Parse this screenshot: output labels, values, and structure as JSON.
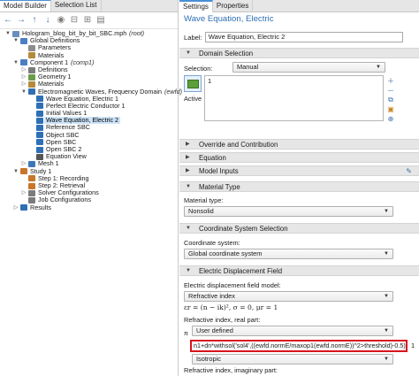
{
  "left": {
    "tabs": [
      "Model Builder",
      "Selection List"
    ],
    "tree": [
      {
        "label": "Hologram_blog_bit_by_bit_SBC.mph",
        "suffix": "(root)",
        "toggle": "▼",
        "icon": "file-icon",
        "color": "#6a8fbf"
      },
      {
        "label": "Global Definitions",
        "toggle": "▼",
        "icon": "globe-icon",
        "color": "#4b7fc4"
      },
      {
        "label": "Parameters",
        "toggle": "",
        "icon": "parameters-icon",
        "color": "#8c8c8c"
      },
      {
        "label": "Materials",
        "toggle": "",
        "icon": "materials-icon",
        "color": "#b58a3c"
      },
      {
        "label": "Component 1",
        "suffix": "(comp1)",
        "toggle": "▼",
        "icon": "component-icon",
        "color": "#4b7fc4"
      },
      {
        "label": "Definitions",
        "toggle": "▷",
        "icon": "definitions-icon",
        "color": "#7b7b7b"
      },
      {
        "label": "Geometry 1",
        "toggle": "▷",
        "icon": "geometry-icon",
        "color": "#6b9c4a"
      },
      {
        "label": "Materials",
        "toggle": "▷",
        "icon": "materials-icon",
        "color": "#b58a3c"
      },
      {
        "label": "Electromagnetic Waves, Frequency Domain",
        "suffix": "(ewfd)",
        "toggle": "▼",
        "icon": "physics-icon",
        "color": "#2f6fb5"
      },
      {
        "label": "Wave Equation, Electric 1",
        "toggle": "",
        "icon": "wave-equation-icon",
        "color": "#2f6fb5"
      },
      {
        "label": "Perfect Electric Conductor 1",
        "toggle": "",
        "icon": "boundary-icon",
        "color": "#2f6fb5"
      },
      {
        "label": "Initial Values 1",
        "toggle": "",
        "icon": "initial-values-icon",
        "color": "#2f6fb5"
      },
      {
        "label": "Wave Equation, Electric 2",
        "toggle": "",
        "icon": "wave-equation-icon",
        "color": "#2f6fb5",
        "selected": true
      },
      {
        "label": "Reference SBC",
        "toggle": "",
        "icon": "boundary-icon",
        "color": "#2f6fb5"
      },
      {
        "label": "Object SBC",
        "toggle": "",
        "icon": "boundary-icon",
        "color": "#2f6fb5"
      },
      {
        "label": "Open SBC",
        "toggle": "",
        "icon": "boundary-icon",
        "color": "#2f6fb5"
      },
      {
        "label": "Open SBC 2",
        "toggle": "",
        "icon": "boundary-icon",
        "color": "#2f6fb5"
      },
      {
        "label": "Equation View",
        "toggle": "",
        "icon": "equation-view-icon",
        "color": "#555555"
      },
      {
        "label": "Mesh 1",
        "toggle": "▷",
        "icon": "mesh-icon",
        "color": "#3c78b8"
      },
      {
        "label": "Study 1",
        "toggle": "▼",
        "icon": "study-icon",
        "color": "#c7762a"
      },
      {
        "label": "Step 1: Recording",
        "toggle": "",
        "icon": "step-icon",
        "color": "#c7762a"
      },
      {
        "label": "Step 2: Retrieval",
        "toggle": "",
        "icon": "step-icon",
        "color": "#c7762a"
      },
      {
        "label": "Solver Configurations",
        "toggle": "▷",
        "icon": "solver-icon",
        "color": "#7b7b7b"
      },
      {
        "label": "Job Configurations",
        "toggle": "",
        "icon": "job-icon",
        "color": "#7b7b7b"
      },
      {
        "label": "Results",
        "toggle": "▷",
        "icon": "results-icon",
        "color": "#2f6fb5"
      }
    ]
  },
  "right": {
    "tabs": [
      "Settings",
      "Properties"
    ],
    "feature_title": "Wave Equation, Electric",
    "label_caption": "Label:",
    "label_value": "Wave Equation, Electric 2",
    "sections": {
      "domain_selection": "Domain Selection",
      "override": "Override and Contribution",
      "equation": "Equation",
      "model_inputs": "Model Inputs",
      "material_type": "Material Type",
      "coordinate_system": "Coordinate System Selection",
      "electric_displacement": "Electric Displacement Field"
    },
    "selection_caption": "Selection:",
    "selection_value": "Manual",
    "selection_list_value": "1",
    "active_caption": "Active",
    "material_type_caption": "Material type:",
    "material_type_value": "Nonsolid",
    "coord_caption": "Coordinate system:",
    "coord_value": "Global coordinate system",
    "edf_caption": "Electric displacement field model:",
    "edf_value": "Refractive index",
    "material_equation": "εr = (n − ik)², σ = 0, μr = 1",
    "ri_real_caption": "Refractive index, real part:",
    "n_symbol": "n",
    "ri_real_source": "User defined",
    "ri_real_expression": "n1+dn*withsol('sol4',((ewfd.normE/maxop1(ewfd.normE))^2>threshold)-0.5)",
    "ri_real_unit": "1",
    "ri_real_isotropy": "Isotropic",
    "ri_imag_caption": "Refractive index, imaginary part:"
  }
}
